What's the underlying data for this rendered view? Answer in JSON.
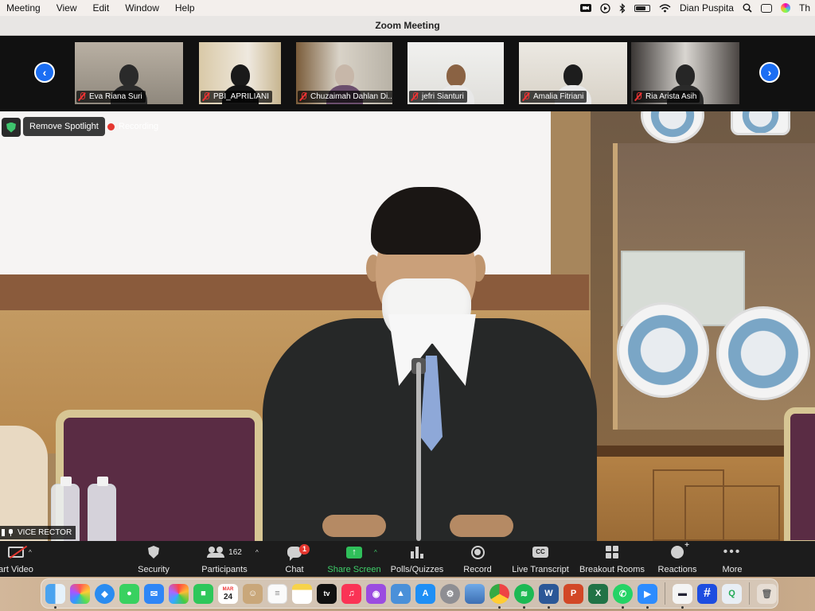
{
  "menubar": {
    "items": [
      "Meeting",
      "View",
      "Edit",
      "Window",
      "Help"
    ],
    "user": "Dian Puspita",
    "clock_fragment": "Th"
  },
  "window": {
    "title": "Zoom Meeting"
  },
  "thumbnails": [
    {
      "name": "Eva Riana Suri",
      "muted": true
    },
    {
      "name": "PBI_APRILIANI",
      "muted": true
    },
    {
      "name": "Chuzaimah Dahlan Di...",
      "muted": true
    },
    {
      "name": "jefri Sianturi",
      "muted": true
    },
    {
      "name": "Amalia Fitriani",
      "muted": true
    },
    {
      "name": "Ria Arista Asih",
      "muted": true
    }
  ],
  "spotlight": {
    "remove_label": "Remove Spotlight",
    "recording_label": "Recording",
    "speaker_name": "VICE RECTOR"
  },
  "toolbar": {
    "start_video": "art Video",
    "security": "Security",
    "participants": "Participants",
    "participants_count": "162",
    "chat": "Chat",
    "chat_badge": "1",
    "share_screen": "Share Screen",
    "polls": "Polls/Quizzes",
    "record": "Record",
    "live_transcript": "Live Transcript",
    "live_transcript_icon": "CC",
    "breakout": "Breakout Rooms",
    "reactions": "Reactions",
    "more": "More"
  },
  "dock": {
    "calendar_month": "MAR",
    "calendar_day": "24"
  },
  "colors": {
    "accent_blue": "#1b6ef3",
    "share_green": "#2fbf5a",
    "recording_red": "#e5372f"
  }
}
